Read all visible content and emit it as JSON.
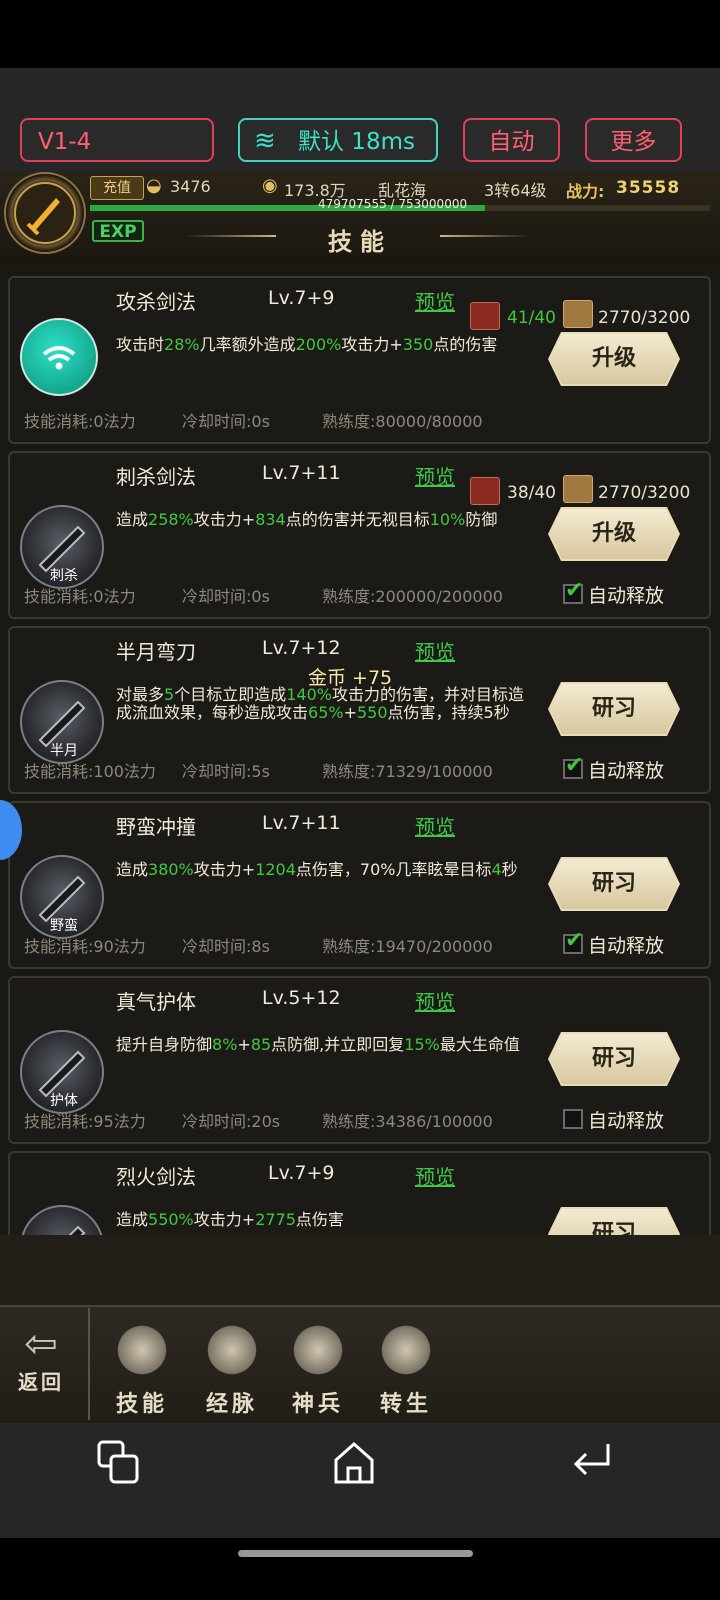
{
  "topbar": {
    "version": "V1-4",
    "network": "默认 18ms",
    "auto": "自动",
    "more": "更多"
  },
  "header": {
    "recharge": "充值",
    "ingot": "3476",
    "coins": "173.8万",
    "player_name": "乱花海",
    "level": "3转64级",
    "power_label": "战力:",
    "power": "35558",
    "exp_text": "479707555 / 753000000",
    "exp_progress": 0.637,
    "exp_tag": "EXP",
    "title": "技能"
  },
  "float_text": "金币  +75",
  "skills": [
    {
      "name": "攻杀剑法",
      "level": "Lv.7+9",
      "preview": "预览",
      "desc_parts": [
        "攻击时",
        "28%",
        "几率额外造成",
        "200%",
        "攻击力+",
        "350",
        "点的伤害"
      ],
      "cost": "技能消耗:0法力",
      "cooldown": "冷却时间:0s",
      "mastery": "熟练度:80000/80000",
      "mat1": "41/40",
      "mat2": "2770/3200",
      "button": "升级",
      "icon_sub": ""
    },
    {
      "name": "刺杀剑法",
      "level": "Lv.7+11",
      "preview": "预览",
      "desc_parts": [
        "造成",
        "258%",
        "攻击力+",
        "834",
        "点的伤害并无视目标",
        "10%",
        "防御"
      ],
      "cost": "技能消耗:0法力",
      "cooldown": "冷却时间:0s",
      "mastery": "熟练度:200000/200000",
      "mat1": "38/40",
      "mat2": "2770/3200",
      "button": "升级",
      "auto": "自动释放",
      "icon_sub": "刺杀"
    },
    {
      "name": "半月弯刀",
      "level": "Lv.7+12",
      "preview": "预览",
      "desc_parts": [
        "对最多",
        "5",
        "个目标立即造成",
        "140%",
        "攻击力的伤害，并对目标造成流血效果，每秒造成攻击",
        "65%",
        "+",
        "550",
        "点伤害，持续5秒"
      ],
      "cost": "技能消耗:100法力",
      "cooldown": "冷却时间:5s",
      "mastery": "熟练度:71329/100000",
      "button": "研习",
      "auto": "自动释放",
      "icon_sub": "半月"
    },
    {
      "name": "野蛮冲撞",
      "level": "Lv.7+11",
      "preview": "预览",
      "desc_parts": [
        "造成",
        "380%",
        "攻击力+",
        "1204",
        "点伤害，70%几率眩晕目标",
        "4",
        "秒"
      ],
      "cost": "技能消耗:90法力",
      "cooldown": "冷却时间:8s",
      "mastery": "熟练度:19470/200000",
      "button": "研习",
      "auto": "自动释放",
      "icon_sub": "野蛮"
    },
    {
      "name": "真气护体",
      "level": "Lv.5+12",
      "preview": "预览",
      "desc_parts": [
        "提升自身防御",
        "8%",
        "+",
        "85",
        "点防御,并立即回复",
        "15%",
        "最大生命值"
      ],
      "cost": "技能消耗:95法力",
      "cooldown": "冷却时间:20s",
      "mastery": "熟练度:34386/100000",
      "button": "研习",
      "auto": "自动释放",
      "icon_sub": "护体"
    },
    {
      "name": "烈火剑法",
      "level": "Lv.7+9",
      "preview": "预览",
      "desc_parts": [
        "造成",
        "550%",
        "攻击力+",
        "2775",
        "点伤害"
      ],
      "button": "研习",
      "icon_sub": ""
    }
  ],
  "nav": {
    "back": "返回",
    "tabs": [
      "技能",
      "经脉",
      "神兵",
      "转生"
    ]
  },
  "colors": {
    "highlight": "#40c840",
    "accent_red": "#e0405a",
    "accent_teal": "#3fd6c0"
  }
}
